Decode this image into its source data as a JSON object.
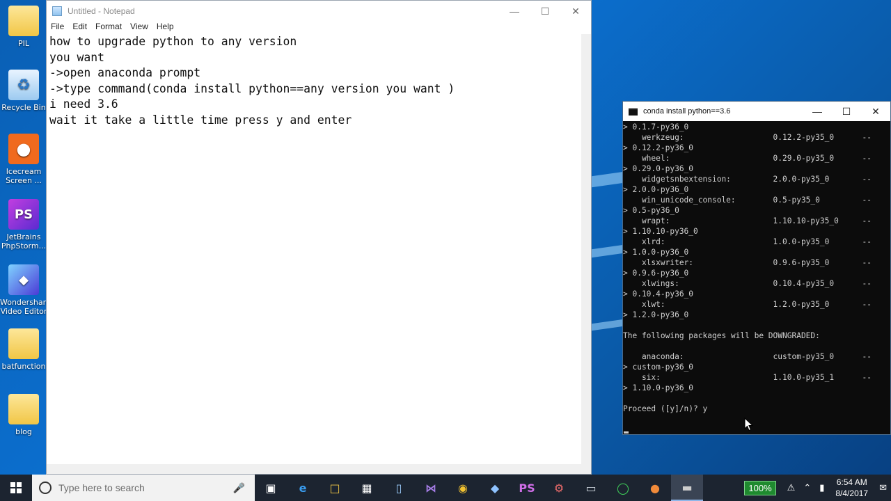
{
  "desktop": {
    "icons": [
      {
        "label": "PIL",
        "icon": "folder-icon"
      },
      {
        "label": "Recycle Bin",
        "icon": "recycle-bin-icon"
      },
      {
        "label": "Icecream Screen ...",
        "icon": "icecream-icon"
      },
      {
        "label": "JetBrains PhpStorm...",
        "icon": "phpstorm-icon"
      },
      {
        "label": "Wondershare Video Editor",
        "icon": "wondershare-icon"
      },
      {
        "label": "batfunction",
        "icon": "folder-icon"
      },
      {
        "label": "blog",
        "icon": "folder-icon"
      }
    ]
  },
  "notepad": {
    "title": "Untitled - Notepad",
    "menu": [
      "File",
      "Edit",
      "Format",
      "View",
      "Help"
    ],
    "lines": [
      "how to upgrade python to any version",
      "you want",
      "->open anaconda prompt",
      "->type command(conda install python==any version you want )",
      "i need 3.6",
      "wait it take a little time press y and enter"
    ]
  },
  "console": {
    "title": "conda  install python==3.6",
    "lines": [
      "> 0.1.7-py36_0",
      "    werkzeug:                   0.12.2-py35_0      --",
      "> 0.12.2-py36_0",
      "    wheel:                      0.29.0-py35_0      --",
      "> 0.29.0-py36_0",
      "    widgetsnbextension:         2.0.0-py35_0       --",
      "> 2.0.0-py36_0",
      "    win_unicode_console:        0.5-py35_0         --",
      "> 0.5-py36_0",
      "    wrapt:                      1.10.10-py35_0     --",
      "> 1.10.10-py36_0",
      "    xlrd:                       1.0.0-py35_0       --",
      "> 1.0.0-py36_0",
      "    xlsxwriter:                 0.9.6-py35_0       --",
      "> 0.9.6-py36_0",
      "    xlwings:                    0.10.4-py35_0      --",
      "> 0.10.4-py36_0",
      "    xlwt:                       1.2.0-py35_0       --",
      "> 1.2.0-py36_0",
      "",
      "The following packages will be DOWNGRADED:",
      "",
      "    anaconda:                   custom-py35_0      --",
      "> custom-py36_0",
      "    six:                        1.10.0-py35_1      --",
      "> 1.10.0-py36_0",
      "",
      "Proceed ([y]/n)? y"
    ]
  },
  "taskbar": {
    "search_placeholder": "Type here to search",
    "zoom": "100%",
    "time": "6:54 AM",
    "date": "8/4/2017"
  }
}
